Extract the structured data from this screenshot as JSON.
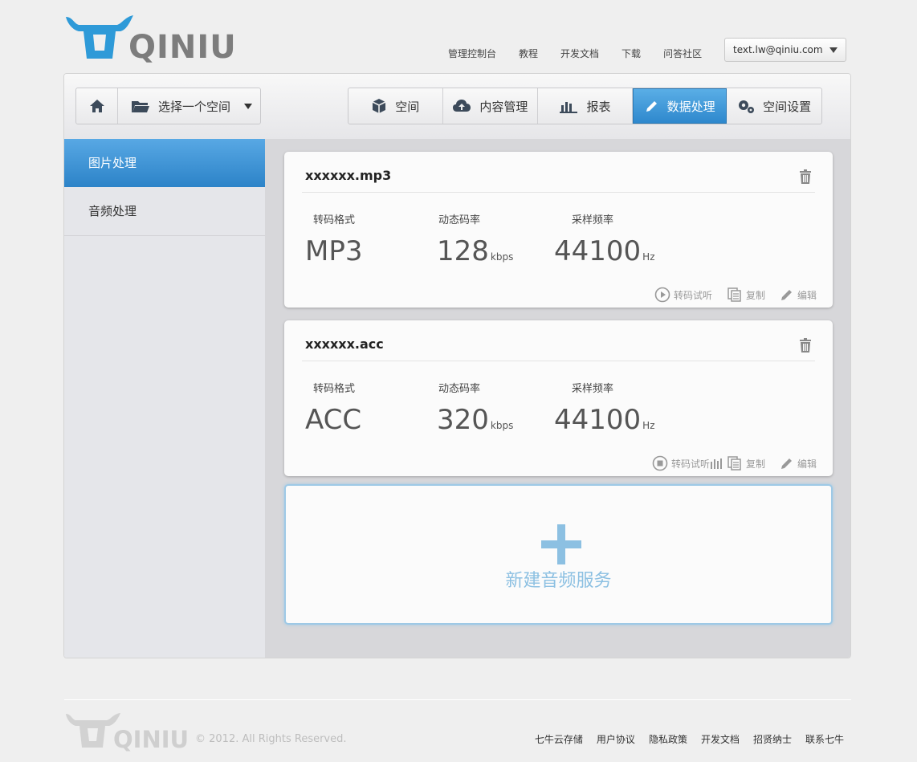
{
  "brand": {
    "name": "QINIU"
  },
  "topnav": [
    "管理控制台",
    "教程",
    "开发文档",
    "下载",
    "问答社区"
  ],
  "user": {
    "email": "text.lw@qiniu.com"
  },
  "toolbar": {
    "space_select": "选择一个空间",
    "tabs": [
      "空间",
      "内容管理",
      "报表",
      "数据处理",
      "空间设置"
    ],
    "active_tab": "数据处理"
  },
  "sidebar": {
    "items": [
      "图片处理",
      "音频处理"
    ],
    "active": "图片处理"
  },
  "cards": [
    {
      "title": "xxxxxx.mp3",
      "labels": [
        "转码格式",
        "动态码率",
        "采样频率"
      ],
      "format": "MP3",
      "bitrate": "128",
      "bitrate_unit": "kbps",
      "samplerate": "44100",
      "samplerate_unit": "Hz",
      "actions": [
        "转码试听",
        "复制",
        "编辑"
      ]
    },
    {
      "title": "xxxxxx.acc",
      "labels": [
        "转码格式",
        "动态码率",
        "采样频率"
      ],
      "format": "ACC",
      "bitrate": "320",
      "bitrate_unit": "kbps",
      "samplerate": "44100",
      "samplerate_unit": "Hz",
      "actions": [
        "转码试听",
        "复制",
        "编辑"
      ]
    }
  ],
  "new_service": {
    "label": "新建音频服务"
  },
  "footer": {
    "copyright": "© 2012. All Rights Reserved.",
    "links": [
      "七牛云存储",
      "用户协议",
      "隐私政策",
      "开发文档",
      "招贤纳士",
      "联系七牛"
    ]
  },
  "colors": {
    "accent": "#2e88cd",
    "new_service": "#8cc0e2"
  }
}
